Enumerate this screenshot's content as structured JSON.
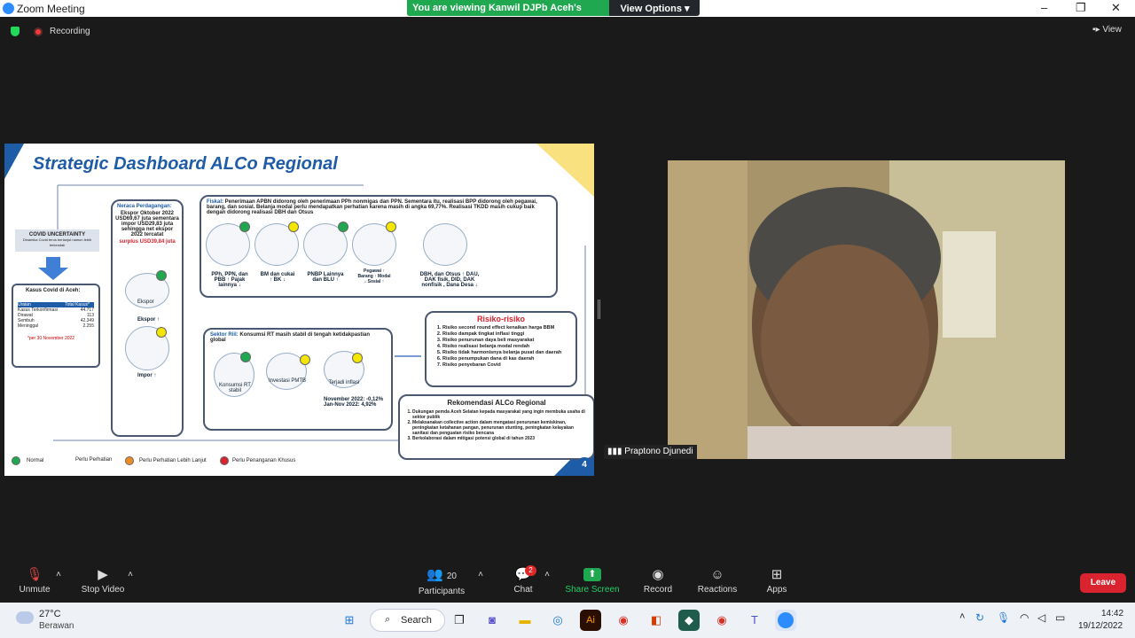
{
  "window": {
    "title": "Zoom Meeting",
    "min": "–",
    "max": "❐",
    "close": "✕"
  },
  "share_banner": {
    "text": "You are viewing Kanwil DJPb Aceh's screen",
    "view_options": "View Options ▾"
  },
  "status": {
    "recording": "Recording",
    "view": "View"
  },
  "slide": {
    "title": "Strategic Dashboard ALCo Regional",
    "covid": {
      "heading": "COVID UNCERTAINTY",
      "sub": "Dinamika Covid terus berlanjut namun lebih terkendali",
      "cases_title": "Kasus Covid di Aceh:",
      "table_header": [
        "Uraian",
        "Total Kasus*"
      ],
      "rows": [
        [
          "Kasus Terkonfirmasi",
          "44.717"
        ],
        [
          "Dirawat",
          "113"
        ],
        [
          "Sembuh",
          "42.349"
        ],
        [
          "Meninggal",
          "2.255"
        ]
      ],
      "note": "*per 30 November 2022"
    },
    "neraca": {
      "heading": "Neraca Perdagangan:",
      "text": "Ekspor Oktober 2022 USD69,67 juta sementara impor USD29,83 juta sehingga net ekspor 2022 tercatat",
      "surplus": "surplus USD39,84 juta",
      "ekspor": "Ekspor",
      "ekspor_arrow": "Ekspor ↑",
      "impor": "Impor ↑"
    },
    "fiskal": {
      "heading": "Fiskal",
      "text": ": Penerimaan APBN didorong oleh penerimaan PPh nonmigas dan PPN. Sementara itu, realisasi BPP didorong oleh pegawai, barang, dan sosial. Belanja modal perlu mendapatkan perhatian karena masih di angka 69,77%. Realisasi TKDD masih cukup baik dengan didorong realisasi DBH dan Otsus",
      "items": [
        "PPh, PPN, dan PBB ↑ Pajak lainnya ↓",
        "BM dan cukai ↑ BK ↓",
        "PNBP Lainnya dan BLU ↑",
        "Pegawai ↑ Barang ↑ Modal ↓ Sosial ↑",
        "DBH, dan Otsus ↑ DAU, DAK fisik, DID, DAK nonfisik , Dana Desa ↓"
      ]
    },
    "riil": {
      "heading": "Sektor Riil:",
      "text": "Konsumsi RT masih stabil di tengah ketidakpastian global",
      "items": [
        "Konsumsi RT stabil",
        "Investasi PMTB",
        "Terjadi inflasi"
      ],
      "inflasi": "November 2022: -0,12% Jan-Nov 2022: 4,92%"
    },
    "risiko": {
      "heading": "Risiko-risiko",
      "items": [
        "Risiko second round effect kenaikan harga BBM",
        "Risiko dampak tingkat inflasi tinggi",
        "Risiko penurunan daya beli masyarakat",
        "Risiko realisasi belanja modal rendah",
        "Risiko tidak harmonisnya belanja pusat dan daerah",
        "Risiko penumpukan dana di kas daerah",
        "Risiko penyebaran Covid"
      ]
    },
    "rekomendasi": {
      "heading": "Rekomendasi ALCo Regional",
      "items": [
        "Dukungan pemda Aceh Selatan kepada masyarakat yang ingin membuka usaha di sektor publik",
        "Melaksanakan collective action dalam mengatasi penurunan kemiskinan, peningkatan ketahanan pangan, penurunan stunting, peningkatan kelayakan sanitasi dan penguatan risiko bencana",
        "Berkolaborasi dalam mitigasi potensi global di tahun 2023"
      ]
    },
    "legend": [
      "Normal",
      "Perlu Perhatian",
      "Perlu Perhatian Lebih Lanjut",
      "Perlu Penanganan Khusus"
    ],
    "page": "4"
  },
  "participant": {
    "name": "Praptono Djunedi"
  },
  "toolbar": {
    "unmute": "Unmute",
    "video": "Stop Video",
    "participants": "Participants",
    "participants_count": "20",
    "chat": "Chat",
    "chat_badge": "2",
    "share": "Share Screen",
    "record": "Record",
    "reactions": "Reactions",
    "apps": "Apps",
    "leave": "Leave"
  },
  "taskbar": {
    "temp": "27°C",
    "weather": "Berawan",
    "search": "Search",
    "time": "14:42",
    "date": "19/12/2022"
  },
  "colors": {
    "normal": "#1fa84f",
    "perhatian": "#f5e600",
    "lanjut": "#f08a24",
    "khusus": "#d9232e"
  }
}
